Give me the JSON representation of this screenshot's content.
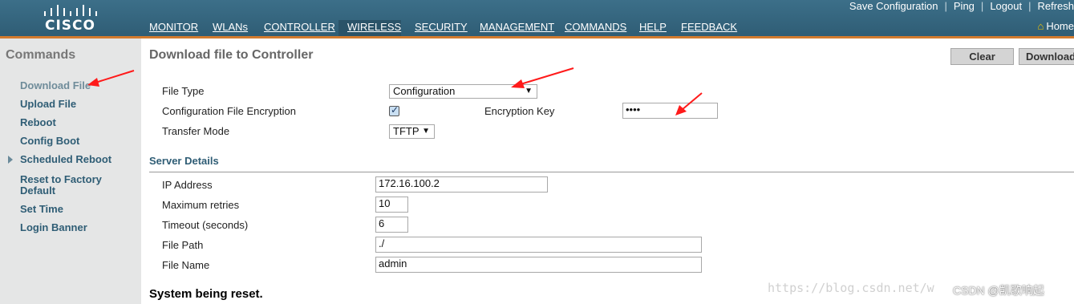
{
  "header": {
    "logo_text": "CISCO",
    "top_links": [
      "Save Configuration",
      "Ping",
      "Logout",
      "Refresh"
    ],
    "nav": [
      "MONITOR",
      "WLANs",
      "CONTROLLER",
      "WIRELESS",
      "SECURITY",
      "MANAGEMENT",
      "COMMANDS",
      "HELP",
      "FEEDBACK"
    ],
    "active_nav": "WIRELESS",
    "home_label": "Home",
    "accent_color": "#d37b2e"
  },
  "sidebar": {
    "title": "Commands",
    "items": [
      {
        "label": "Download File",
        "active": true
      },
      {
        "label": "Upload File"
      },
      {
        "label": "Reboot"
      },
      {
        "label": "Config Boot"
      },
      {
        "label": "Scheduled Reboot",
        "expandable": true
      },
      {
        "label": "Reset to Factory Default"
      },
      {
        "label": "Set Time"
      },
      {
        "label": "Login Banner"
      }
    ]
  },
  "main": {
    "title": "Download file to Controller",
    "buttons": {
      "clear": "Clear",
      "download": "Download"
    },
    "file_type": {
      "label": "File Type",
      "value": "Configuration"
    },
    "encryption": {
      "label": "Configuration File Encryption",
      "checked": true
    },
    "encryption_key": {
      "label": "Encryption Key",
      "value": "••••"
    },
    "transfer_mode": {
      "label": "Transfer Mode",
      "value": "TFTP"
    },
    "server_details": {
      "title": "Server Details",
      "ip_address": {
        "label": "IP Address",
        "value": "172.16.100.2"
      },
      "max_retries": {
        "label": "Maximum retries",
        "value": "10"
      },
      "timeout": {
        "label": "Timeout (seconds)",
        "value": "6"
      },
      "file_path": {
        "label": "File Path",
        "value": "./"
      },
      "file_name": {
        "label": "File Name",
        "value": "admin"
      }
    },
    "status": "System being reset."
  },
  "watermark": {
    "url": "https://blog.csdn.net/w",
    "brand": "CSDN @凯歌响起"
  }
}
